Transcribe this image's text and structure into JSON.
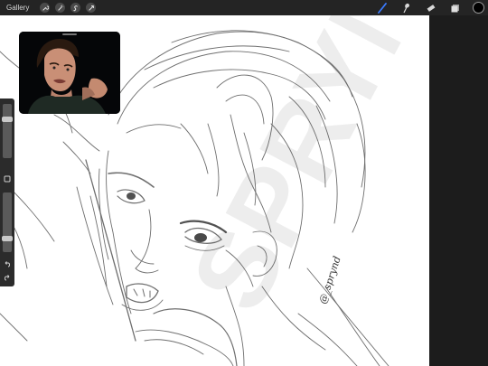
{
  "topbar": {
    "gallery_label": "Gallery",
    "left_tools": [
      "wrench-icon",
      "magic-wand-icon",
      "selection-icon",
      "transform-icon"
    ],
    "right_tools": [
      "brush-icon",
      "smudge-icon",
      "eraser-icon",
      "layers-icon"
    ],
    "current_color": "#000000",
    "brush_accent": "#3a7bff"
  },
  "sidebar": {
    "brush_size_level": 0.75,
    "opacity_level": 0.2,
    "modify_button": "square-icon",
    "undo_button": "undo-icon",
    "redo_button": "redo-icon"
  },
  "canvas": {
    "watermark_text": "SPRYND",
    "signature_text": "@_sprynd"
  },
  "reference": {
    "description_icon": "reference-photo"
  }
}
